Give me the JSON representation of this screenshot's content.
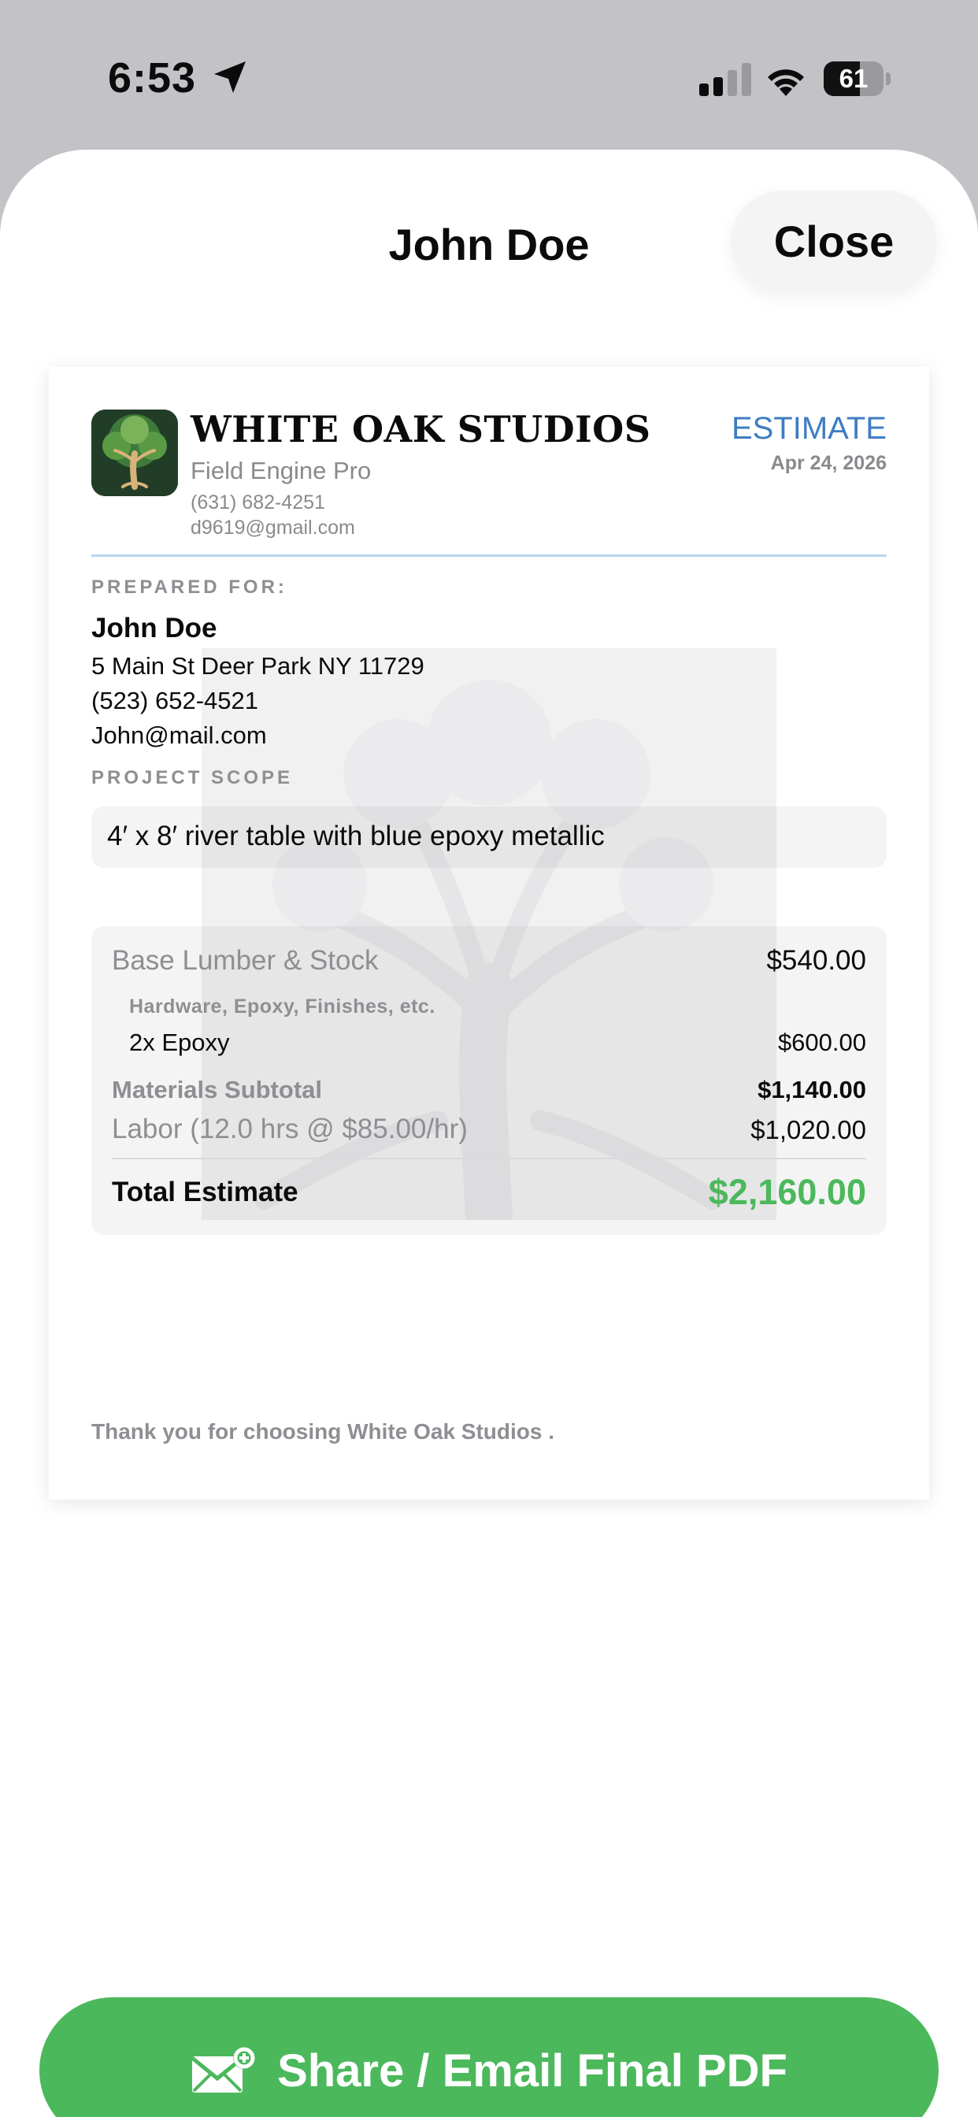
{
  "status_bar": {
    "time": "6:53",
    "battery_level": "61",
    "battery_fraction": 0.61,
    "icons": [
      "location-arrow-icon",
      "cellular-signal-icon",
      "wifi-icon",
      "battery-icon"
    ]
  },
  "sheet": {
    "title": "John Doe",
    "close_label": "Close"
  },
  "estimate": {
    "company": {
      "name": "WHITE OAK STUDIOS",
      "tagline": "Field Engine Pro",
      "phone": "(631) 682-4251",
      "email": "d9619@gmail.com",
      "logo_icon": "oak-tree-logo-icon"
    },
    "doc_type": "ESTIMATE",
    "date": "Apr 24, 2026",
    "prepared_for": {
      "label": "PREPARED FOR:",
      "name": "John Doe",
      "address": "5 Main St Deer Park NY 11729",
      "phone": "(523) 652-4521",
      "email": "John@mail.com"
    },
    "scope": {
      "label": "PROJECT SCOPE",
      "text": "4′ x 8′ river table with blue epoxy metallic"
    },
    "costs": {
      "base_label": "Base Lumber & Stock",
      "base_amount": "$540.00",
      "hardware_label": "Hardware, Epoxy, Finishes, etc.",
      "items": [
        {
          "label": "2x Epoxy",
          "amount": "$600.00"
        }
      ],
      "materials_subtotal_label": "Materials Subtotal",
      "materials_subtotal_amount": "$1,140.00",
      "labor_label": "Labor (12.0 hrs @ $85.00/hr)",
      "labor_amount": "$1,020.00",
      "total_label": "Total Estimate",
      "total_amount": "$2,160.00"
    },
    "footer": "Thank you for choosing White Oak Studios ."
  },
  "share_button": {
    "label": "Share / Email Final PDF",
    "icon": "mail-send-icon"
  },
  "colors": {
    "accent_green": "#4cb85c",
    "estimate_blue": "#3f7dc2",
    "rule_blue": "#b8d4ef",
    "status_bar_bg": "#c3c2c7"
  }
}
